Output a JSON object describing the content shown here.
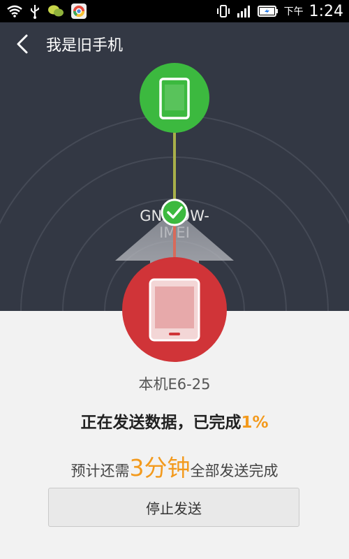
{
  "status_bar": {
    "icons_left": [
      "wifi-icon",
      "usb-icon",
      "wechat-icon",
      "chrome-icon"
    ],
    "icons_right": [
      "vibrate-icon",
      "signal-icon",
      "battery-charging-icon"
    ],
    "ampm": "下午",
    "time": "1:24"
  },
  "header": {
    "title": "我是旧手机",
    "back_icon": "chevron-left-icon"
  },
  "transfer": {
    "old_device_name": "GN709W-\nIMEI",
    "old_device_line1": "GN709W-",
    "old_device_line2": "IMEI",
    "local_device_name": "本机E6-25",
    "status_text": "正在发送数据，已完成",
    "progress_percent": "1%",
    "remaining_prefix": "预计还需",
    "remaining_value": "3分钟",
    "remaining_suffix": "全部发送完成"
  },
  "actions": {
    "stop_label": "停止发送"
  },
  "colors": {
    "header_bg": "#333844",
    "old_phone_green": "#3cb93f",
    "local_phone_red": "#d03438",
    "accent_orange": "#f39a1d",
    "body_bg": "#f2f2f2"
  }
}
